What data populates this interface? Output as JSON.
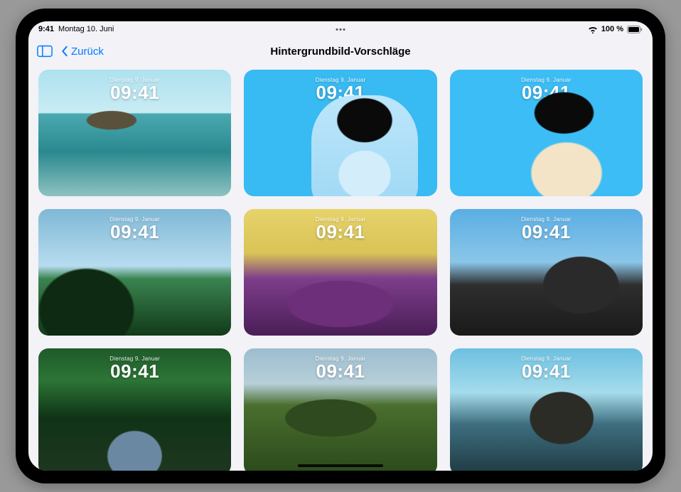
{
  "statusBar": {
    "time": "9:41",
    "date": "Montag 10. Juni",
    "batteryText": "100 %"
  },
  "nav": {
    "backLabel": "Zurück",
    "title": "Hintergrundbild-Vorschläge"
  },
  "tileOverlay": {
    "date": "Dienstag 9. Januar",
    "time": "09:41"
  },
  "tiles": [
    {
      "name": "wallpaper-1-volcano-lagoon"
    },
    {
      "name": "wallpaper-2-portrait-blue-bubble"
    },
    {
      "name": "wallpaper-3-portrait-blue-smile"
    },
    {
      "name": "wallpaper-4-jungle-cliff"
    },
    {
      "name": "wallpaper-5-coast-duotone"
    },
    {
      "name": "wallpaper-6-black-beach-rock"
    },
    {
      "name": "wallpaper-7-forest-stream"
    },
    {
      "name": "wallpaper-8-highland-cliffs"
    },
    {
      "name": "wallpaper-9-sea-stack"
    }
  ]
}
